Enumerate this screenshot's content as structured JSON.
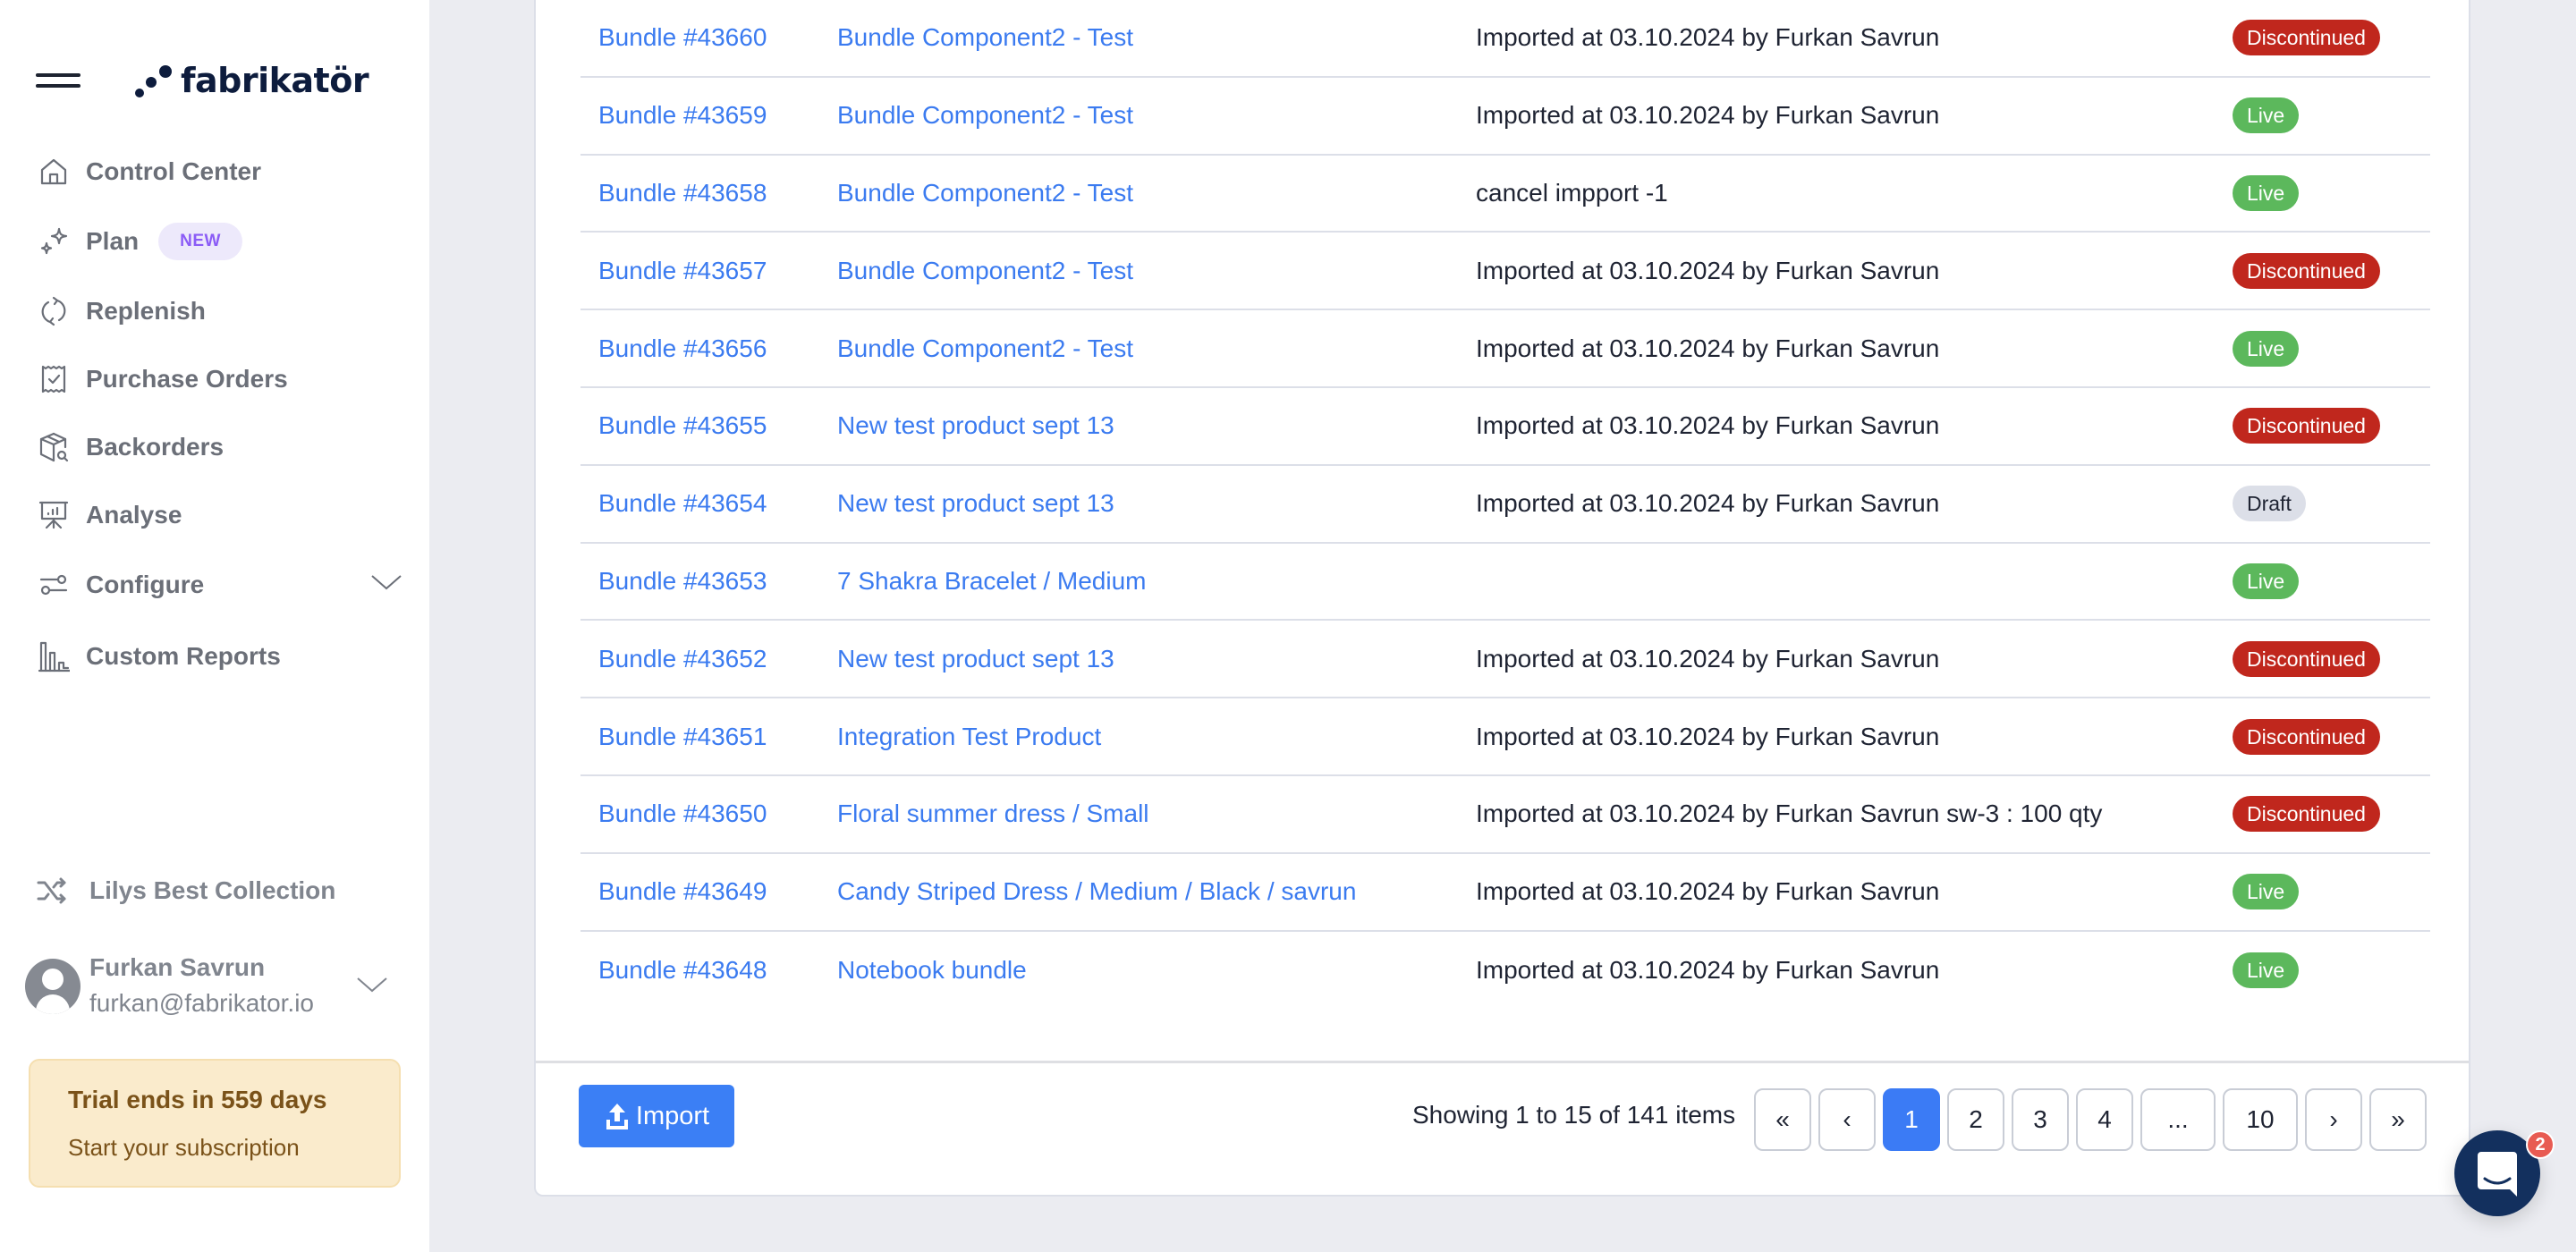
{
  "app": {
    "logo_text": "fabrikatör"
  },
  "sidebar": {
    "items": [
      {
        "label": "Control Center",
        "icon": "home-icon"
      },
      {
        "label": "Plan",
        "icon": "sparkles-icon",
        "badge": "NEW"
      },
      {
        "label": "Replenish",
        "icon": "refresh-icon"
      },
      {
        "label": "Purchase Orders",
        "icon": "receipt-check-icon"
      },
      {
        "label": "Backorders",
        "icon": "package-search-icon"
      },
      {
        "label": "Analyse",
        "icon": "presentation-chart-icon"
      },
      {
        "label": "Configure",
        "icon": "sliders-icon",
        "has_chevron": true
      },
      {
        "label": "Custom Reports",
        "icon": "bar-chart-icon"
      }
    ],
    "store": {
      "label": "Lilys Best Collection",
      "icon": "shuffle-icon"
    },
    "user": {
      "name": "Furkan Savrun",
      "email": "furkan@fabrikator.io"
    },
    "trial": {
      "title": "Trial ends in 559 days",
      "subtitle": "Start your subscription"
    }
  },
  "table": {
    "rows": [
      {
        "id": "Bundle #43660",
        "name": "Bundle Component2 - Test",
        "description": "Imported at 03.10.2024 by Furkan Savrun",
        "status": "Discontinued"
      },
      {
        "id": "Bundle #43659",
        "name": "Bundle Component2 - Test",
        "description": "Imported at 03.10.2024 by Furkan Savrun",
        "status": "Live"
      },
      {
        "id": "Bundle #43658",
        "name": "Bundle Component2 - Test",
        "description": "cancel impport -1",
        "status": "Live"
      },
      {
        "id": "Bundle #43657",
        "name": "Bundle Component2 - Test",
        "description": "Imported at 03.10.2024 by Furkan Savrun",
        "status": "Discontinued"
      },
      {
        "id": "Bundle #43656",
        "name": "Bundle Component2 - Test",
        "description": "Imported at 03.10.2024 by Furkan Savrun",
        "status": "Live"
      },
      {
        "id": "Bundle #43655",
        "name": "New test product sept 13",
        "description": "Imported at 03.10.2024 by Furkan Savrun",
        "status": "Discontinued"
      },
      {
        "id": "Bundle #43654",
        "name": "New test product sept 13",
        "description": "Imported at 03.10.2024 by Furkan Savrun",
        "status": "Draft"
      },
      {
        "id": "Bundle #43653",
        "name": "7 Shakra Bracelet / Medium",
        "description": "",
        "status": "Live"
      },
      {
        "id": "Bundle #43652",
        "name": "New test product sept 13",
        "description": "Imported at 03.10.2024 by Furkan Savrun",
        "status": "Discontinued"
      },
      {
        "id": "Bundle #43651",
        "name": "Integration Test Product",
        "description": "Imported at 03.10.2024 by Furkan Savrun",
        "status": "Discontinued"
      },
      {
        "id": "Bundle #43650",
        "name": "Floral summer dress / Small",
        "description": "Imported at 03.10.2024 by Furkan Savrun sw-3 : 100 qty",
        "status": "Discontinued"
      },
      {
        "id": "Bundle #43649",
        "name": "Candy Striped Dress / Medium / Black / savrun",
        "description": "Imported at 03.10.2024 by Furkan Savrun",
        "status": "Live"
      },
      {
        "id": "Bundle #43648",
        "name": "Notebook bundle",
        "description": "Imported at 03.10.2024 by Furkan Savrun",
        "status": "Live"
      }
    ]
  },
  "footer": {
    "import_label": "Import",
    "showing_text": "Showing 1 to 15 of 141 items",
    "pagination": [
      {
        "label": "«",
        "name": "first-page-button"
      },
      {
        "label": "‹",
        "name": "prev-page-button"
      },
      {
        "label": "1",
        "name": "page-1-button",
        "active": true
      },
      {
        "label": "2",
        "name": "page-2-button"
      },
      {
        "label": "3",
        "name": "page-3-button"
      },
      {
        "label": "4",
        "name": "page-4-button"
      },
      {
        "label": "...",
        "name": "page-ellipsis-button",
        "wide": true
      },
      {
        "label": "10",
        "name": "page-10-button",
        "wide": true
      },
      {
        "label": "›",
        "name": "next-page-button"
      },
      {
        "label": "»",
        "name": "last-page-button"
      }
    ]
  },
  "chat": {
    "unread_count": "2"
  },
  "colors": {
    "accent": "#3B7BF0",
    "live": "#5CB85C",
    "discontinued": "#C0271D",
    "draft": "#DCDFE8",
    "new_badge": "#8B5CF6",
    "chat": "#13305E"
  }
}
